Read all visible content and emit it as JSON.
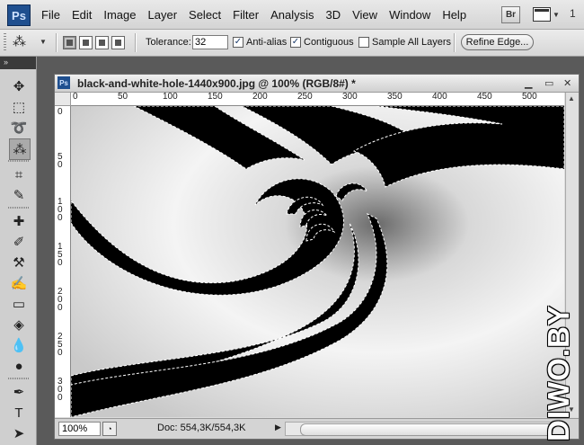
{
  "app": {
    "logo": "Ps"
  },
  "menubar": {
    "items": [
      "File",
      "Edit",
      "Image",
      "Layer",
      "Select",
      "Filter",
      "Analysis",
      "3D",
      "View",
      "Window",
      "Help"
    ],
    "bridge_label": "Br",
    "trailing_number": "1"
  },
  "options": {
    "tool_icon": "magic-wand-icon",
    "tolerance_label": "Tolerance:",
    "tolerance_value": "32",
    "anti_alias_label": "Anti-alias",
    "anti_alias_checked": true,
    "contiguous_label": "Contiguous",
    "contiguous_checked": true,
    "sample_all_layers_label": "Sample All Layers",
    "sample_all_layers_checked": false,
    "refine_edge_label": "Refine Edge..."
  },
  "tools": [
    {
      "name": "move-tool-icon",
      "glyph": "✥"
    },
    {
      "name": "marquee-tool-icon",
      "glyph": "⬚"
    },
    {
      "name": "lasso-tool-icon",
      "glyph": "➰"
    },
    {
      "name": "magic-wand-tool-icon",
      "glyph": "⁂",
      "active": true
    },
    {
      "name": "crop-tool-icon",
      "glyph": "⌗"
    },
    {
      "name": "eyedropper-tool-icon",
      "glyph": "✎"
    },
    {
      "name": "healing-brush-tool-icon",
      "glyph": "✚"
    },
    {
      "name": "brush-tool-icon",
      "glyph": "✐"
    },
    {
      "name": "clone-stamp-tool-icon",
      "glyph": "⚒"
    },
    {
      "name": "history-brush-tool-icon",
      "glyph": "✍"
    },
    {
      "name": "eraser-tool-icon",
      "glyph": "▭"
    },
    {
      "name": "paint-bucket-tool-icon",
      "glyph": "◈"
    },
    {
      "name": "blur-tool-icon",
      "glyph": "💧"
    },
    {
      "name": "dodge-tool-icon",
      "glyph": "●"
    },
    {
      "name": "pen-tool-icon",
      "glyph": "✒"
    },
    {
      "name": "type-tool-icon",
      "glyph": "T"
    },
    {
      "name": "path-selection-tool-icon",
      "glyph": "➤"
    }
  ],
  "document": {
    "title": "black-and-white-hole-1440x900.jpg @ 100% (RGB/8#) *",
    "ps_badge": "Ps",
    "hruler_labels": [
      "0",
      "50",
      "100",
      "150",
      "200",
      "250",
      "300",
      "350",
      "400",
      "450",
      "500"
    ],
    "vruler_labels": [
      "0",
      "50",
      "100",
      "150",
      "200",
      "250",
      "300"
    ],
    "zoom": "100%",
    "doc_info": "Doc: 554,3K/554,3K"
  },
  "watermark": "DIWO.BY"
}
